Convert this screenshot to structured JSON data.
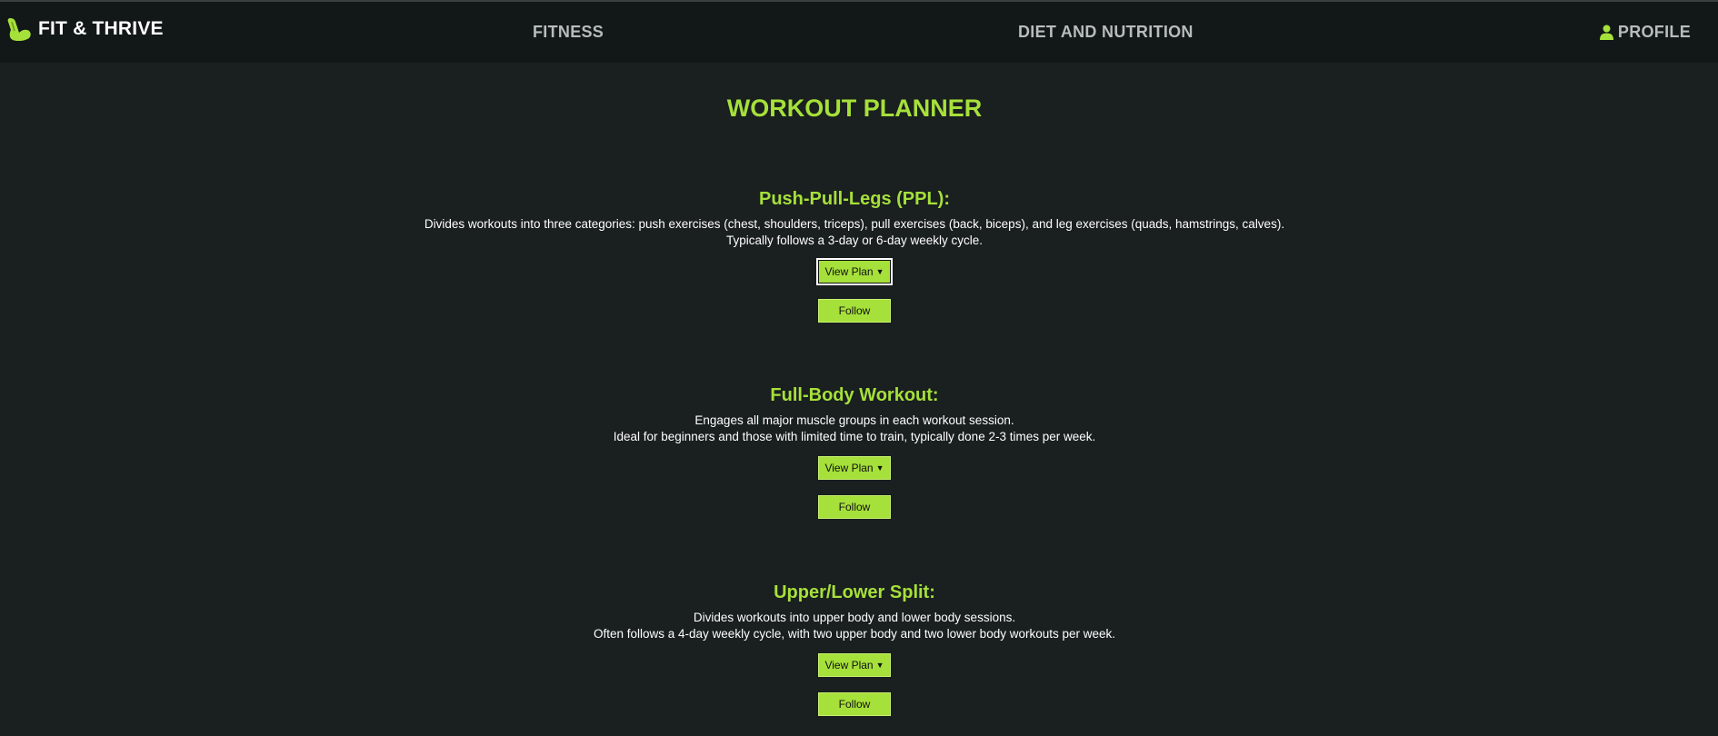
{
  "nav": {
    "brand": "FIT & THRIVE",
    "brand_icon": "flexed-arm-icon",
    "links": [
      "FITNESS",
      "DIET AND NUTRITION"
    ],
    "profile": "PROFILE",
    "profile_icon": "user-icon"
  },
  "page": {
    "title": "WORKOUT PLANNER"
  },
  "plans": [
    {
      "title": "Push-Pull-Legs (PPL):",
      "line1": "Divides workouts into three categories: push exercises (chest, shoulders, triceps), pull exercises (back, biceps), and leg exercises (quads, hamstrings, calves).",
      "line2": "Typically follows a 3-day or 6-day weekly cycle.",
      "view_label": "View Plan",
      "follow_label": "Follow"
    },
    {
      "title": "Full-Body Workout:",
      "line1": "Engages all major muscle groups in each workout session.",
      "line2": "Ideal for beginners and those with limited time to train, typically done 2-3 times per week.",
      "view_label": "View Plan",
      "follow_label": "Follow"
    },
    {
      "title": "Upper/Lower Split:",
      "line1": "Divides workouts into upper body and lower body sessions.",
      "line2": "Often follows a 4-day weekly cycle, with two upper body and two lower body workouts per week.",
      "view_label": "View Plan",
      "follow_label": "Follow"
    }
  ],
  "colors": {
    "accent": "#a6e03a",
    "background": "#1a1f1f",
    "navbar": "#121717"
  }
}
